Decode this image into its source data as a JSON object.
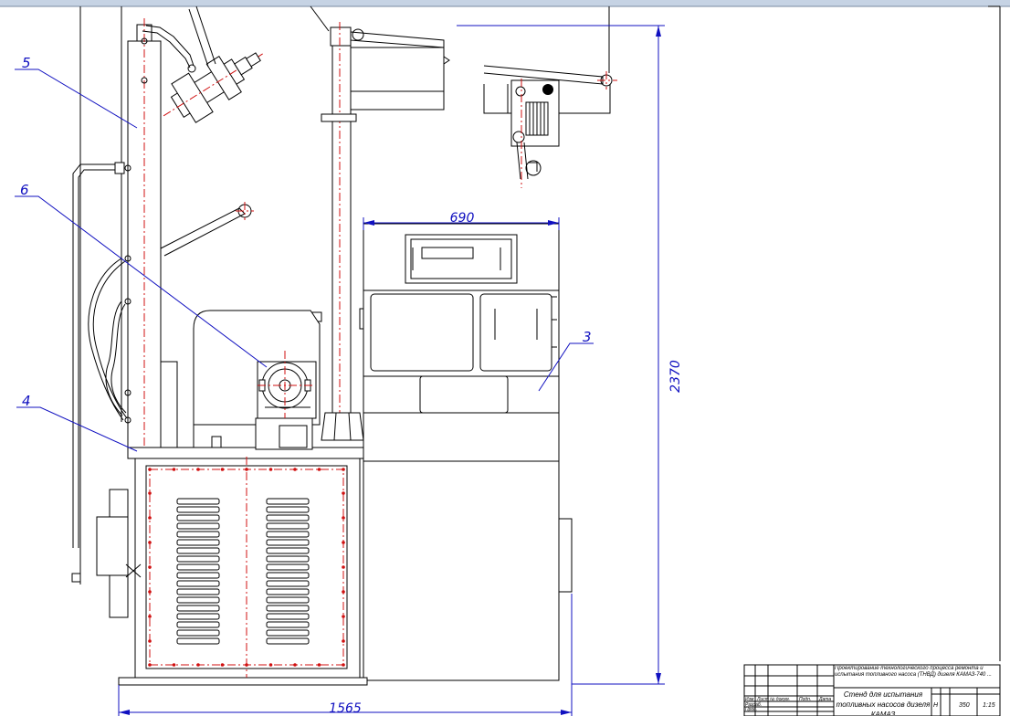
{
  "colors": {
    "outline": "#000000",
    "axis": "#d01010",
    "dimension": "#1010c0",
    "topbar": "#c6d3e4"
  },
  "dimensions": {
    "height": "2370",
    "width_top": "690",
    "width_bottom": "1565"
  },
  "callouts": [
    "5",
    "6",
    "4",
    "3"
  ],
  "title_block": {
    "project_title": "Проектирование технологического процесса ремонта и испытания топливного насоса (ТНВД) дизеля КАМАЗ-740 ...",
    "drawing_name": "Стенд для испытания топливных насосов дизеля КАМАЗ",
    "stage": "Н",
    "mass": "350",
    "scale": "1:15",
    "row_labels": [
      "Изм",
      "Лист",
      "№ докум.",
      "Подп.",
      "Дата",
      "Разраб.",
      "Пров."
    ]
  }
}
